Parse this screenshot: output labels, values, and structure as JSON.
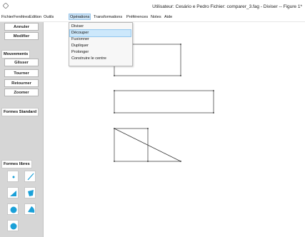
{
  "window": {
    "title": "Utilisateur: Cesário e Pedro  Fichier: comparer_3.fag - Diviser -- Figure 1*"
  },
  "menubar": {
    "items": [
      "Fichier",
      "Fenêtres",
      "Edition",
      "Outils",
      "Opérations",
      "Transformations",
      "Préférences",
      "Notes",
      "Aide"
    ],
    "active": "Opérations"
  },
  "operations_menu": {
    "items": [
      "Diviser",
      "Découper",
      "Fusionner",
      "Dupliquer",
      "Prolonger",
      "Construire le centre"
    ],
    "highlighted": "Découper"
  },
  "sidebar": {
    "annuler": "Annuler",
    "modifier": "Modifier",
    "mouvements_label": "Mouvements",
    "glisser": "Glisser",
    "tourner": "Tourner",
    "retourner": "Retourner",
    "zoomer": "Zoomer",
    "formes_standard_label": "Formes Standard",
    "formes_libres_label": "Formes libres",
    "tools": [
      "point-icon",
      "segment-icon",
      "triangle-icon",
      "quadrilateral-icon",
      "circle-icon",
      "circular-sector-icon",
      "ellipse-icon"
    ]
  },
  "colors": {
    "tool_fill": "#1aa0d8",
    "panel_bg": "#d6d6d6",
    "menu_highlight": "#cde8fb"
  }
}
